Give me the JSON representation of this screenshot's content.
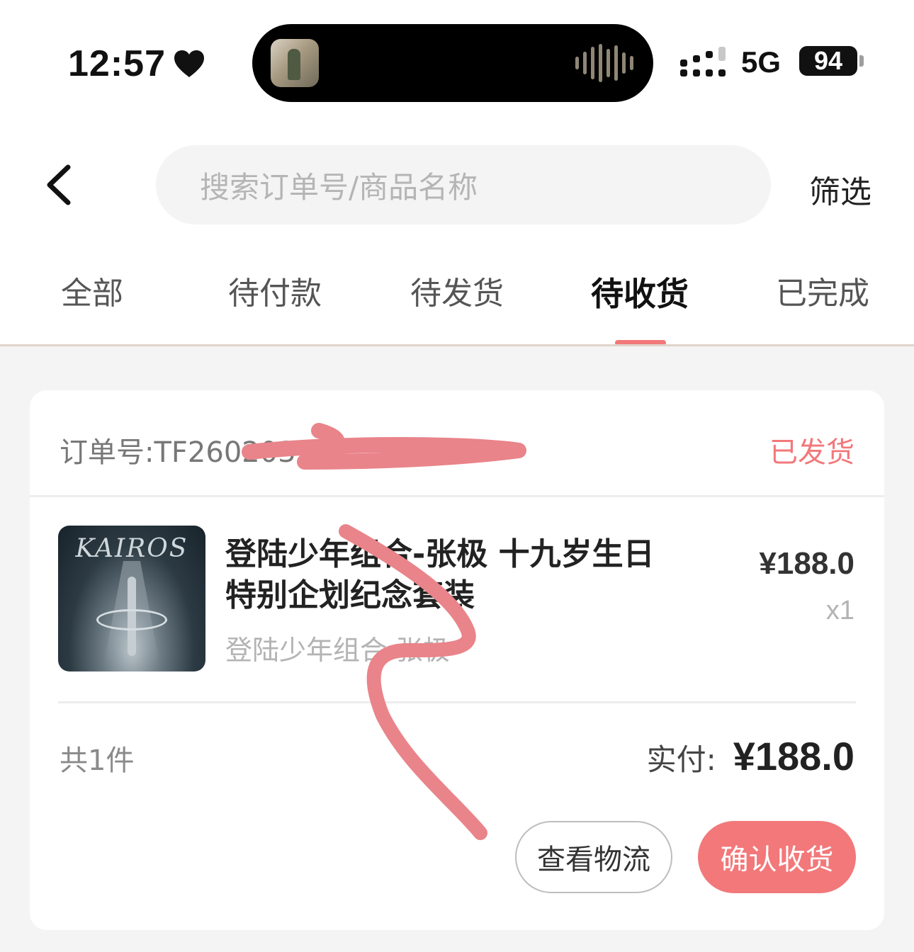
{
  "status_bar": {
    "time": "12:57",
    "network": "5G",
    "battery": "94"
  },
  "header": {
    "back_icon": "chevron-left-icon",
    "search_placeholder": "搜索订单号/商品名称",
    "filter_label": "筛选"
  },
  "tabs": [
    {
      "label": "全部",
      "active": false
    },
    {
      "label": "待付款",
      "active": false
    },
    {
      "label": "待发货",
      "active": false
    },
    {
      "label": "待收货",
      "active": true
    },
    {
      "label": "已完成",
      "active": false
    }
  ],
  "order": {
    "number": "订单号:TF260203",
    "status": "已发货",
    "product": {
      "cover_text": "KAIROS",
      "name": "登陆少年组合-张极 十九岁生日特别企划纪念套装",
      "spec": "登陆少年组合:张极",
      "price": "¥188.0",
      "quantity": "x1"
    },
    "total_count": "共1件",
    "paid_label": "实付:",
    "paid_amount": "¥188.0",
    "buttons": {
      "logistics": "查看物流",
      "confirm": "确认收货"
    }
  },
  "colors": {
    "accent": "#f2787a",
    "scribble": "#e9848a",
    "background": "#f4f4f4"
  }
}
